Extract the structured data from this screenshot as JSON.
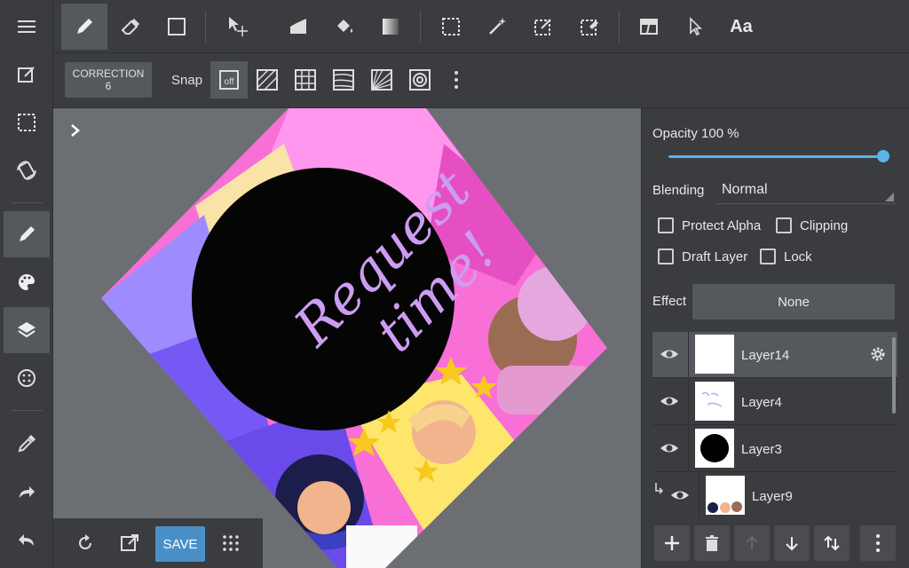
{
  "colors": {
    "accent": "#5ab4e8",
    "save": "#4a90c8",
    "panel": "#3a3c40",
    "active": "#55585d",
    "canvas_bg": "#6b6e73"
  },
  "leftbar": {
    "items": [
      {
        "icon": "menu-icon"
      },
      {
        "icon": "edit-canvas-icon"
      },
      {
        "icon": "selection-icon"
      },
      {
        "icon": "rotate-view-icon"
      },
      {
        "icon": "brush-icon"
      },
      {
        "icon": "palette-icon"
      },
      {
        "icon": "layers-icon"
      },
      {
        "icon": "materials-icon"
      },
      {
        "icon": "eyedropper-icon"
      },
      {
        "icon": "redo-icon"
      },
      {
        "icon": "undo-icon"
      }
    ]
  },
  "toolbar": {
    "tools": [
      "pen-icon",
      "eraser-icon",
      "shape-icon",
      "move-icon",
      "fill-shape-icon",
      "bucket-icon",
      "gradient-icon",
      "select-rect-icon",
      "magic-wand-icon",
      "select-pen-icon",
      "select-eraser-icon",
      "frame-divider-icon",
      "pointer-icon"
    ],
    "text_tool_label": "Aa"
  },
  "subbar": {
    "correction_label": "CORRECTION",
    "correction_value": "6",
    "snap_label": "Snap",
    "snap_off_label": "off"
  },
  "canvas": {
    "artwork_text_line1": "Request",
    "artwork_text_line2": "time!"
  },
  "bottom_tools": {
    "save_label": "SAVE"
  },
  "layer_panel": {
    "opacity_label": "Opacity 100 %",
    "opacity_value": 1.0,
    "blending_label": "Blending",
    "blending_value": "Normal",
    "protect_alpha_label": "Protect Alpha",
    "clipping_label": "Clipping",
    "draft_layer_label": "Draft Layer",
    "lock_label": "Lock",
    "effect_label": "Effect",
    "effect_value": "None",
    "layers": [
      {
        "name": "Layer14",
        "thumb": "white"
      },
      {
        "name": "Layer4",
        "thumb": "text"
      },
      {
        "name": "Layer3",
        "thumb": "circle"
      },
      {
        "name": "Layer9",
        "thumb": "characters"
      }
    ]
  }
}
